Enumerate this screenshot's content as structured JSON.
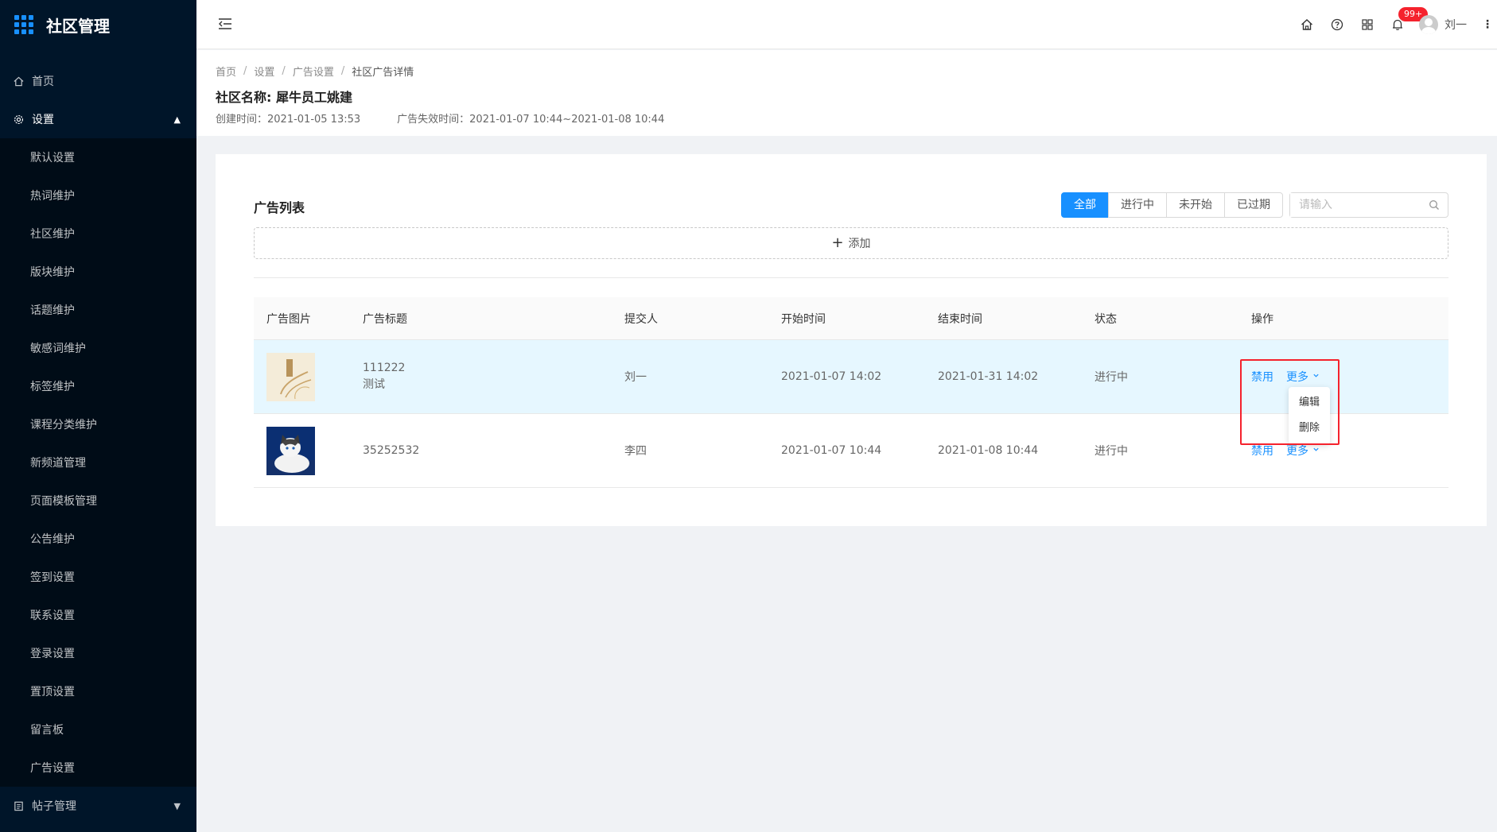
{
  "app": {
    "title": "社区管理"
  },
  "sidebar": {
    "items": [
      {
        "label": "首页",
        "icon": "home-icon"
      },
      {
        "label": "设置",
        "icon": "gear-icon",
        "expanded": true,
        "children": [
          "默认设置",
          "热词维护",
          "社区维护",
          "版块维护",
          "话题维护",
          "敏感词维护",
          "标签维护",
          "课程分类维护",
          "新频道管理",
          "页面模板管理",
          "公告维护",
          "签到设置",
          "联系设置",
          "登录设置",
          "置顶设置",
          "留言板",
          "广告设置"
        ]
      },
      {
        "label": "帖子管理",
        "icon": "document-icon",
        "expanded": false
      }
    ]
  },
  "header": {
    "notification_count": "99+",
    "user_name": "刘一"
  },
  "breadcrumb": [
    "首页",
    "设置",
    "广告设置",
    "社区广告详情"
  ],
  "page": {
    "community_label": "社区名称:",
    "community_name": "犀牛员工姚建",
    "created": "创建时间：2021-01-05 13:53",
    "expire": "广告失效时间：2021-01-07 10:44~2021-01-08 10:44"
  },
  "ad_list": {
    "title": "广告列表",
    "filters": [
      "全部",
      "进行中",
      "未开始",
      "已过期"
    ],
    "active_filter": "全部",
    "search_placeholder": "请输入",
    "add_label": "添加",
    "columns": [
      "广告图片",
      "广告标题",
      "提交人",
      "开始时间",
      "结束时间",
      "状态",
      "操作"
    ],
    "rows": [
      {
        "title_line1": "111222",
        "title_line2": "测试",
        "submitter": "刘一",
        "start": "2021-01-07 14:02",
        "end": "2021-01-31 14:02",
        "status": "进行中",
        "action_disable": "禁用",
        "action_more": "更多"
      },
      {
        "title_line1": "35252532",
        "title_line2": "",
        "submitter": "李四",
        "start": "2021-01-07 10:44",
        "end": "2021-01-08 10:44",
        "status": "进行中",
        "action_disable": "禁用",
        "action_more": "更多"
      }
    ],
    "dropdown": [
      "编辑",
      "删除"
    ]
  },
  "colors": {
    "primary": "#1890ff",
    "sidebar_bg": "#001529",
    "highlight": "#f5222d"
  }
}
